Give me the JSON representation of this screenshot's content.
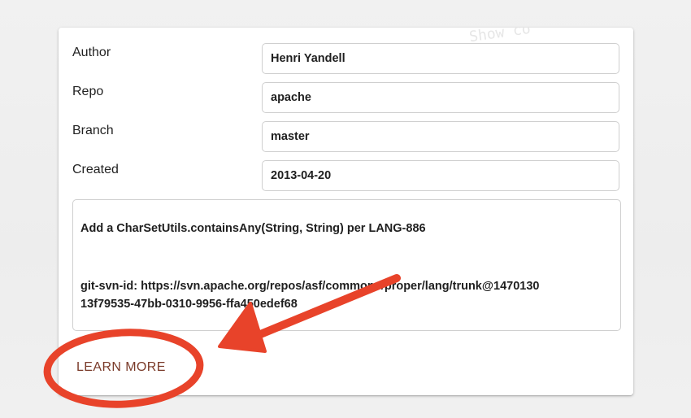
{
  "fields": [
    {
      "label": "Author",
      "value": "Henri Yandell"
    },
    {
      "label": "Repo",
      "value": "apache"
    },
    {
      "label": "Branch",
      "value": "master"
    },
    {
      "label": "Created",
      "value": "2013-04-20"
    }
  ],
  "message": {
    "line1": "Add a CharSetUtils.containsAny(String, String) per LANG-886",
    "line2": "git-svn-id: https://svn.apache.org/repos/asf/commons/proper/lang/trunk@1470130",
    "line3": "13f79535-47bb-0310-9956-ffa450edef68"
  },
  "actions": {
    "learn_more": "LEARN MORE"
  },
  "annotation": {
    "color": "#e8432a",
    "marks": [
      "arrow",
      "ellipse-highlight"
    ]
  }
}
